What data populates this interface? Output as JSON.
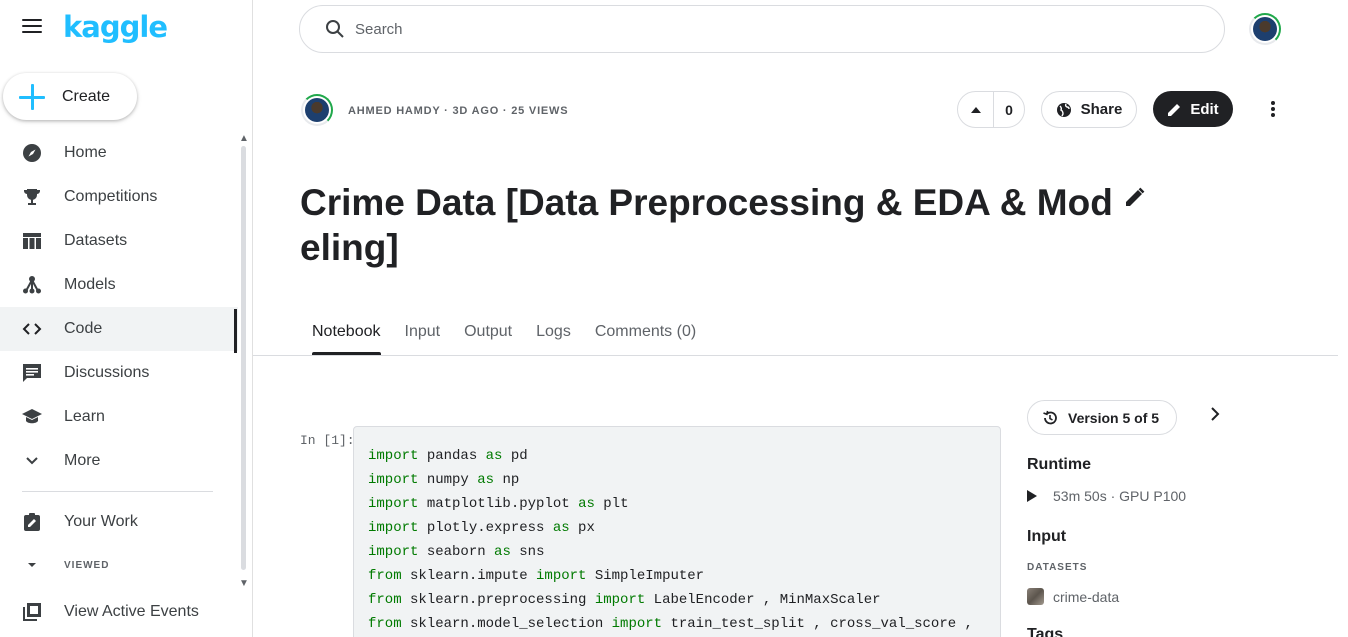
{
  "sidebar": {
    "logo": "kaggle",
    "create_label": "Create",
    "items": [
      {
        "label": "Home",
        "icon": "compass-icon"
      },
      {
        "label": "Competitions",
        "icon": "trophy-icon"
      },
      {
        "label": "Datasets",
        "icon": "table-icon"
      },
      {
        "label": "Models",
        "icon": "models-icon"
      },
      {
        "label": "Code",
        "icon": "code-icon",
        "active": true
      },
      {
        "label": "Discussions",
        "icon": "comment-icon"
      },
      {
        "label": "Learn",
        "icon": "school-icon"
      },
      {
        "label": "More",
        "icon": "chevron-down-icon"
      }
    ],
    "your_work": "Your Work",
    "viewed_label": "VIEWED",
    "active_events": "View Active Events"
  },
  "search": {
    "placeholder": "Search"
  },
  "notebook": {
    "meta": "AHMED HAMDY · 3D AGO · 25 VIEWS",
    "votes": "0",
    "share_label": "Share",
    "edit_label": "Edit",
    "title": "Crime Data [Data Preprocessing & EDA & Modeling]"
  },
  "tabs": [
    "Notebook",
    "Input",
    "Output",
    "Logs",
    "Comments (0)"
  ],
  "cell": {
    "prompt": "In [1]:",
    "lines": [
      [
        {
          "t": "import",
          "k": 1
        },
        {
          "t": " pandas "
        },
        {
          "t": "as",
          "k": 1
        },
        {
          "t": " pd"
        }
      ],
      [
        {
          "t": "import",
          "k": 1
        },
        {
          "t": " numpy "
        },
        {
          "t": "as",
          "k": 1
        },
        {
          "t": " np"
        }
      ],
      [
        {
          "t": "import",
          "k": 1
        },
        {
          "t": " matplotlib.pyplot "
        },
        {
          "t": "as",
          "k": 1
        },
        {
          "t": " plt"
        }
      ],
      [
        {
          "t": "import",
          "k": 1
        },
        {
          "t": " plotly.express "
        },
        {
          "t": "as",
          "k": 1
        },
        {
          "t": " px"
        }
      ],
      [
        {
          "t": "import",
          "k": 1
        },
        {
          "t": " seaborn "
        },
        {
          "t": "as",
          "k": 1
        },
        {
          "t": " sns"
        }
      ],
      [
        {
          "t": "from",
          "k": 1
        },
        {
          "t": " sklearn.impute "
        },
        {
          "t": "import",
          "k": 1
        },
        {
          "t": " SimpleImputer"
        }
      ],
      [
        {
          "t": "from",
          "k": 1
        },
        {
          "t": " sklearn.preprocessing "
        },
        {
          "t": "import",
          "k": 1
        },
        {
          "t": " LabelEncoder , MinMaxScaler"
        }
      ],
      [
        {
          "t": "from",
          "k": 1
        },
        {
          "t": " sklearn.model_selection "
        },
        {
          "t": "import",
          "k": 1
        },
        {
          "t": " train_test_split , cross_val_score ,"
        }
      ]
    ]
  },
  "right_panel": {
    "version_label": "Version 5 of 5",
    "runtime_heading": "Runtime",
    "runtime_value": "53m 50s · GPU P100",
    "input_heading": "Input",
    "datasets_label": "DATASETS",
    "dataset_name": "crime-data",
    "tags_heading": "Tags"
  },
  "colors": {
    "brand": "#20beff",
    "keyword": "#007a00",
    "edit_bg": "#202124"
  }
}
